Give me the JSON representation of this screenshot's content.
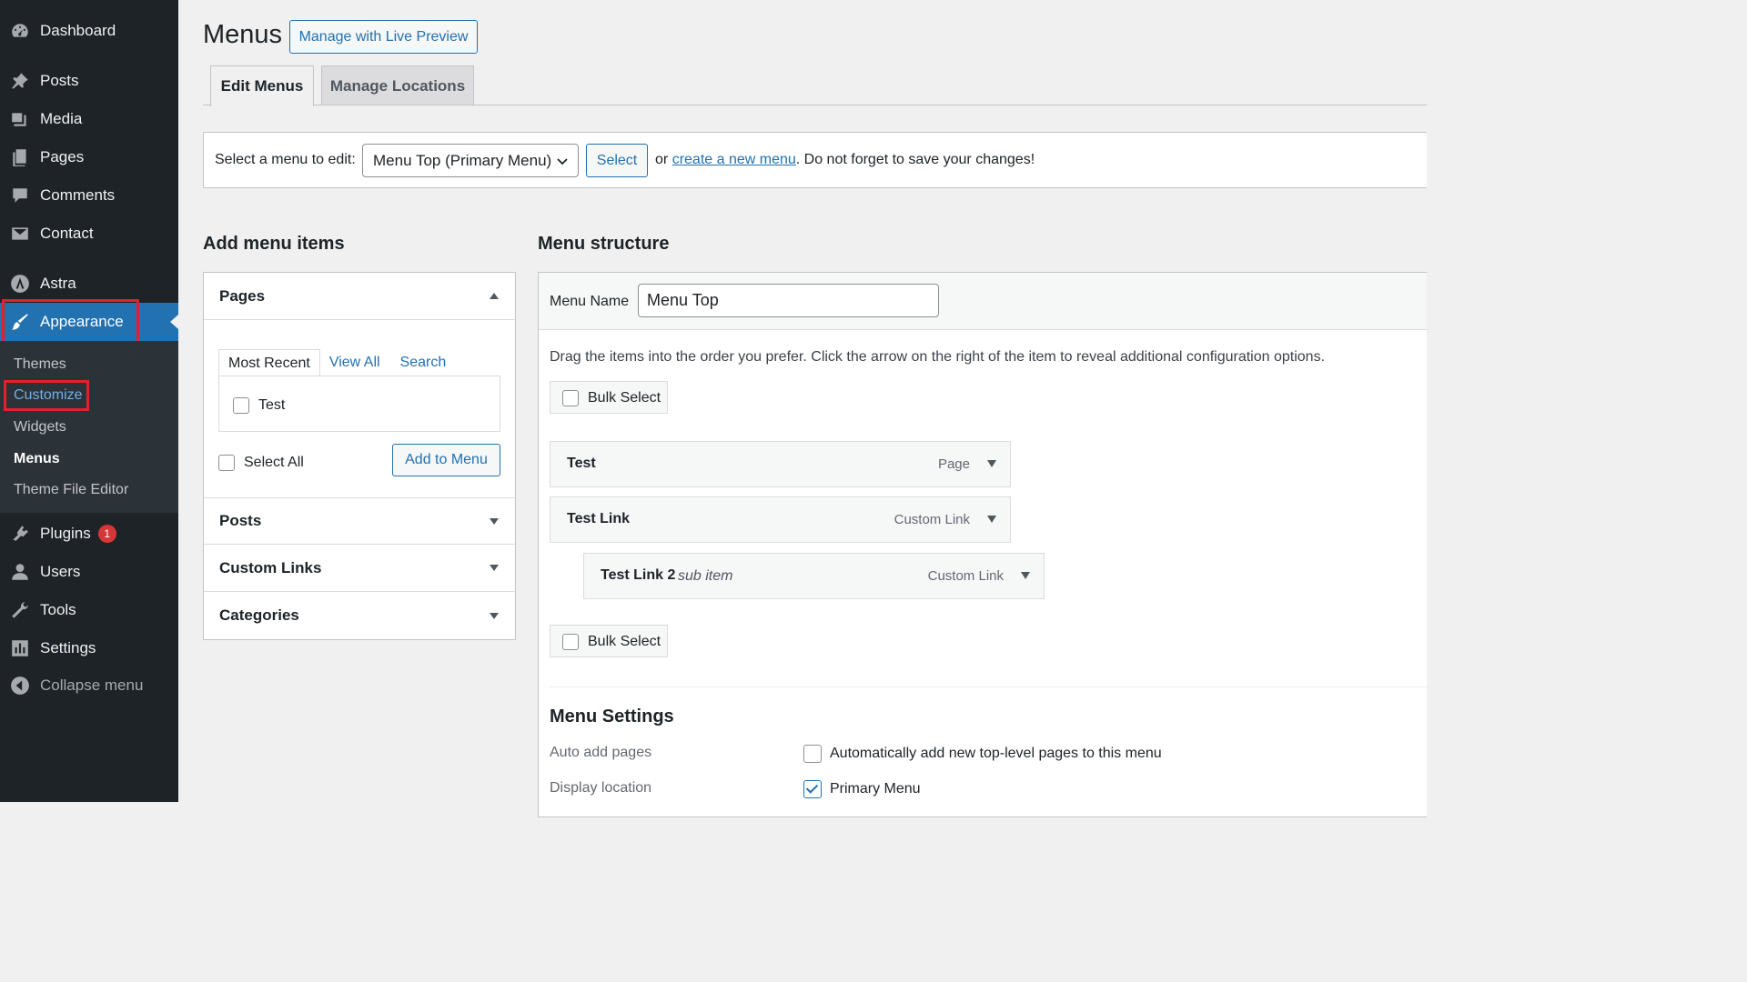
{
  "sidebar": {
    "items": [
      {
        "label": "Dashboard",
        "icon": "dashboard-icon"
      },
      {
        "label": "Posts",
        "icon": "pin-icon"
      },
      {
        "label": "Media",
        "icon": "media-icon"
      },
      {
        "label": "Pages",
        "icon": "pages-icon"
      },
      {
        "label": "Comments",
        "icon": "comment-icon"
      },
      {
        "label": "Contact",
        "icon": "mail-icon"
      },
      {
        "label": "Astra",
        "icon": "astra-icon"
      },
      {
        "label": "Appearance",
        "icon": "brush-icon"
      },
      {
        "label": "Plugins",
        "icon": "plugin-icon",
        "badge": "1"
      },
      {
        "label": "Users",
        "icon": "users-icon"
      },
      {
        "label": "Tools",
        "icon": "wrench-icon"
      },
      {
        "label": "Settings",
        "icon": "settings-icon"
      },
      {
        "label": "Collapse menu",
        "icon": "collapse-icon"
      }
    ],
    "submenu": [
      "Themes",
      "Customize",
      "Widgets",
      "Menus",
      "Theme File Editor"
    ]
  },
  "page": {
    "title": "Menus",
    "live_preview": "Manage with Live Preview",
    "tabs": [
      "Edit Menus",
      "Manage Locations"
    ]
  },
  "select_bar": {
    "label": "Select a menu to edit:",
    "selected": "Menu Top (Primary Menu)",
    "select_btn": "Select",
    "or": "or",
    "create_link": "create a new menu",
    "after": ". Do not forget to save your changes!"
  },
  "add_items": {
    "heading": "Add menu items",
    "sections": [
      "Pages",
      "Posts",
      "Custom Links",
      "Categories"
    ],
    "subtabs": [
      "Most Recent",
      "View All",
      "Search"
    ],
    "pages": [
      "Test"
    ],
    "select_all": "Select All",
    "add_btn": "Add to Menu"
  },
  "structure": {
    "heading": "Menu structure",
    "name_label": "Menu Name",
    "name_value": "Menu Top",
    "instructions": "Drag the items into the order you prefer. Click the arrow on the right of the item to reveal additional configuration options.",
    "bulk": "Bulk Select",
    "items": [
      {
        "name": "Test",
        "sub": "",
        "type": "Page"
      },
      {
        "name": "Test Link",
        "sub": "",
        "type": "Custom Link"
      },
      {
        "name": "Test Link 2",
        "sub": "sub item",
        "type": "Custom Link"
      }
    ]
  },
  "settings": {
    "heading": "Menu Settings",
    "auto_label": "Auto add pages",
    "auto_option": "Automatically add new top-level pages to this menu",
    "auto_checked": false,
    "loc_label": "Display location",
    "loc_option": "Primary Menu",
    "loc_checked": true
  },
  "colors": {
    "sidebar": "#1d2327",
    "accent": "#2271b1",
    "highlight": "#e3202d",
    "badge": "#d63638"
  }
}
